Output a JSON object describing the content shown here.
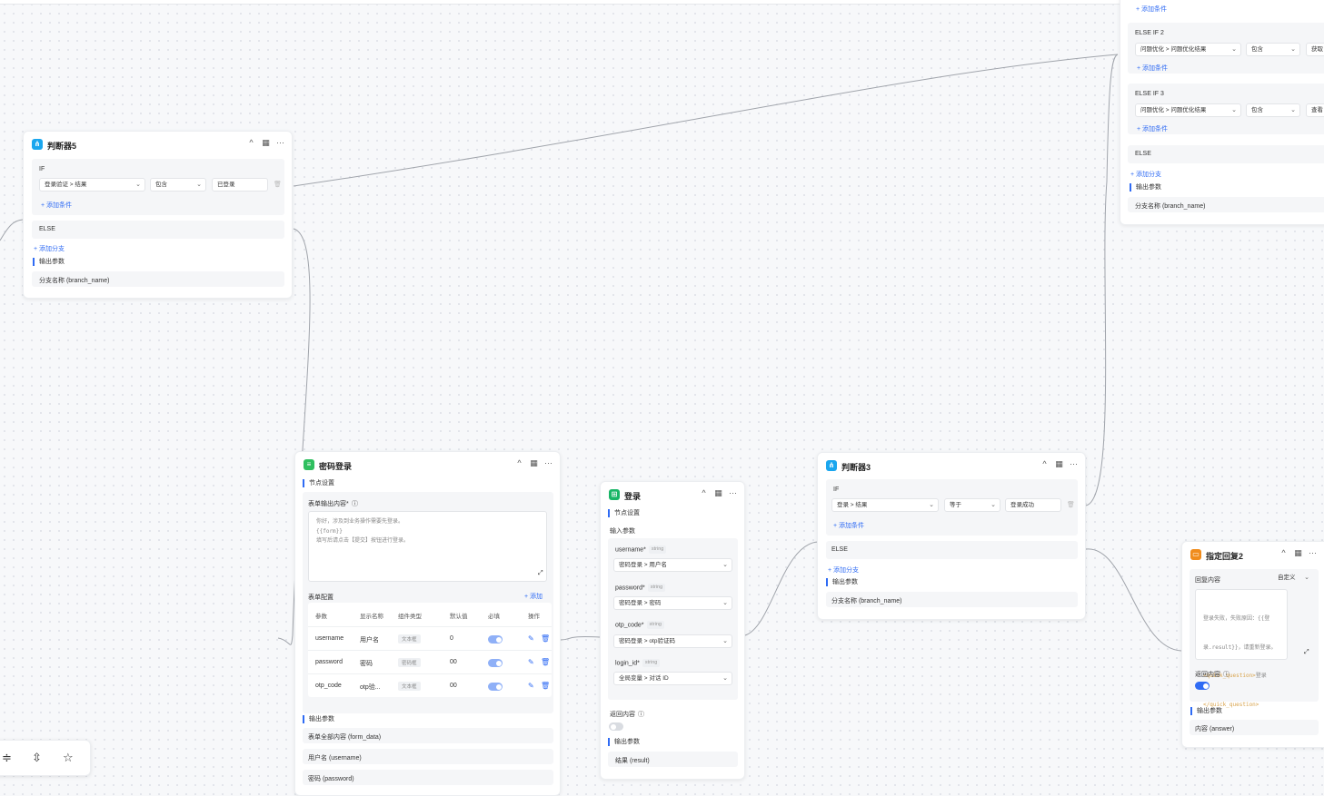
{
  "colors": {
    "accent": "#2f6bf4",
    "condition_icon": "#1aa6ee",
    "form_icon": "#2fbf5f",
    "login_icon": "#18b566",
    "reply_icon": "#f08c1c"
  },
  "common": {
    "add_condition": "+ 添加条件",
    "add_branch": "+ 添加分支",
    "output_params": "输出参数",
    "node_settings": "节点设置",
    "branch_name": "分支名称 (branch_name)",
    "if": "IF",
    "else": "ELSE",
    "collapse_icon": "^",
    "stats_icon": "▦",
    "more_icon": "···"
  },
  "judge5": {
    "title": "判断器5",
    "cond_var": "登录验证 > 结果",
    "cond_op": "包含",
    "cond_value": "已登录"
  },
  "judge_top": {
    "add_condition_top": "+ 添加条件",
    "elseif2": "ELSE IF 2",
    "elseif2_var": "问题优化 > 问题优化结果",
    "elseif2_op": "包含",
    "elseif2_val": "获取",
    "elseif3": "ELSE IF 3",
    "elseif3_var": "问题优化 > 问题优化结果",
    "elseif3_op": "包含",
    "elseif3_val": "查看"
  },
  "pwd_login": {
    "title": "密码登录",
    "form_output_label": "表单输出内容*",
    "form_output_text": "你好，涉及到业务操作需要先登录。\n{{form}}\n填写后请点击【提交】按钮进行登录。",
    "form_config": "表单配置",
    "add": "+ 添加",
    "headers": [
      "参数",
      "显示名称",
      "组件类型",
      "默认值",
      "必填",
      "操作"
    ],
    "rows": [
      {
        "param": "username",
        "display": "用户名",
        "type": "文本框",
        "default": "0"
      },
      {
        "param": "password",
        "display": "密码",
        "type": "密码框",
        "default": "00"
      },
      {
        "param": "otp_code",
        "display": "otp验...",
        "type": "文本框",
        "default": "00"
      }
    ],
    "outputs": [
      "表单全部内容 (form_data)",
      "用户名 (username)",
      "密码 (password)"
    ]
  },
  "login": {
    "title": "登录",
    "input_params": "输入参数",
    "params": [
      {
        "name": "username*",
        "type": "string",
        "value": "密码登录 > 用户名"
      },
      {
        "name": "password*",
        "type": "string",
        "value": "密码登录 > 密码"
      },
      {
        "name": "otp_code*",
        "type": "string",
        "value": "密码登录 > otp验证码"
      },
      {
        "name": "login_id*",
        "type": "string",
        "value": "全局变量 > 对话 ID"
      }
    ],
    "return_content": "返回内容",
    "result": "结果 (result)"
  },
  "judge3": {
    "title": "判断器3",
    "cond_var": "登录 > 结果",
    "cond_op": "等于",
    "cond_value": "登录成功"
  },
  "reply2": {
    "title": "指定回复2",
    "reply_content": "回复内容",
    "mode": "自定义",
    "text_line1": "登录失败，失败原因：{{登",
    "text_line2": "录.result}}，请重新登录。",
    "text_line3_tag": "<quick_question>",
    "text_line3_rest": "登录",
    "text_line4_tag": "</quick_question>",
    "return_content": "返回内容",
    "answer": "内容 (answer)"
  },
  "toolbar": {
    "icon1": "≑",
    "icon2": "⇳",
    "icon3": "☆"
  }
}
